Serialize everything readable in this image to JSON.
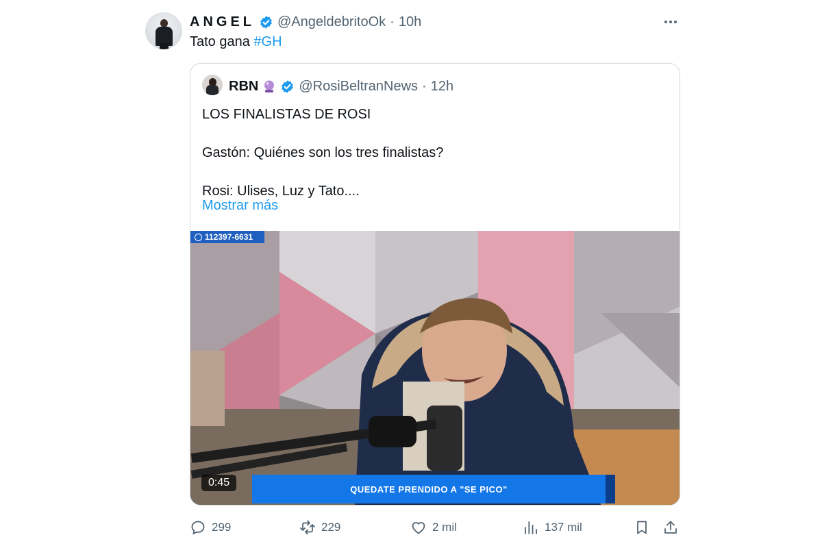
{
  "tweet": {
    "display_name": "ANGEL",
    "handle": "@AngeldebritoOk",
    "separator": "·",
    "time": "10h",
    "text_prefix": "Tato gana ",
    "hashtag": "#GH",
    "avatar_icon": "person-avatar-icon",
    "more_icon": "more-horizontal-icon"
  },
  "quote": {
    "name": "RBN",
    "emoji_icon": "crystal-ball-icon",
    "handle": "@RosiBeltranNews",
    "separator": "·",
    "time": "12h",
    "text": "LOS FINALISTAS DE ROSI\n\nGastón: Quiénes son los tres finalistas?\n\nRosi: Ulises, Luz y Tato....",
    "show_more": "Mostrar más",
    "video": {
      "phone": "112397-6631",
      "duration": "0:45",
      "banner": "QUEDATE PRENDIDO A \"SE PICO\""
    }
  },
  "actions": {
    "replies": "299",
    "retweets": "229",
    "likes": "2 mil",
    "views": "137 mil"
  },
  "colors": {
    "accent": "#1d9bf0",
    "secondary_text": "#536471",
    "banner": "#1477e8"
  }
}
